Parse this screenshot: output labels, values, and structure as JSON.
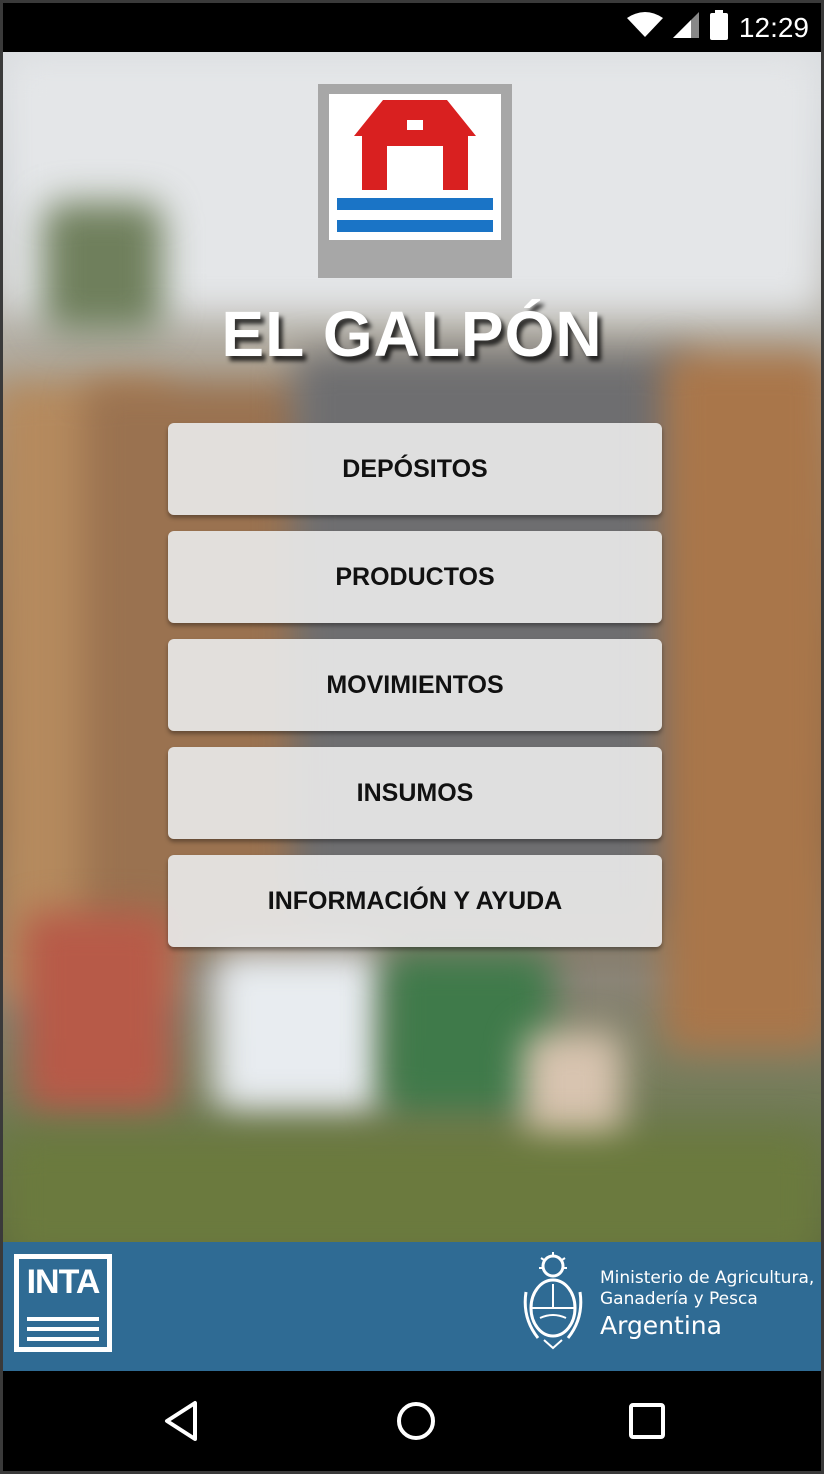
{
  "status_bar": {
    "time": "12:29",
    "icons": [
      "wifi-icon",
      "signal-icon",
      "battery-icon"
    ]
  },
  "app": {
    "title": "EL GALPÓN",
    "logo_icon": "barn-icon"
  },
  "menu": [
    {
      "label": "DEPÓSITOS"
    },
    {
      "label": "PRODUCTOS"
    },
    {
      "label": "MOVIMIENTOS"
    },
    {
      "label": "INSUMOS"
    },
    {
      "label": "INFORMACIÓN Y AYUDA"
    }
  ],
  "footer": {
    "left_logo": "INTA",
    "ministry_line1": "Ministerio de Agricultura,",
    "ministry_line2": "Ganadería y Pesca",
    "ministry_country": "Argentina",
    "seal_icon": "argentina-seal-icon"
  },
  "nav": {
    "icons": [
      "back-icon",
      "home-icon",
      "recents-icon"
    ]
  },
  "colors": {
    "footer_bg": "#2f6b94",
    "barn_red": "#d92020",
    "stripe_blue": "#1a74c6"
  }
}
